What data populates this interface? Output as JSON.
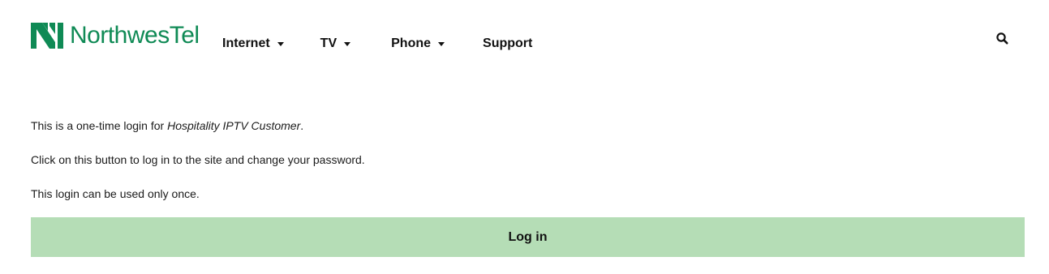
{
  "header": {
    "logo_text": "NorthwesTel",
    "brand_color": "#0f8a55",
    "nav": [
      {
        "label": "Internet",
        "has_dropdown": true
      },
      {
        "label": "TV",
        "has_dropdown": true
      },
      {
        "label": "Phone",
        "has_dropdown": true
      },
      {
        "label": "Support",
        "has_dropdown": false
      }
    ],
    "search_icon": "search-icon"
  },
  "content": {
    "intro_prefix": "This is a one-time login for ",
    "account_name": "Hospitality IPTV Customer",
    "intro_suffix": ".",
    "instruction": "Click on this button to log in to the site and change your password.",
    "notice": "This login can be used only once."
  },
  "login_button": {
    "label": "Log in",
    "color": "#b5ddb6"
  }
}
